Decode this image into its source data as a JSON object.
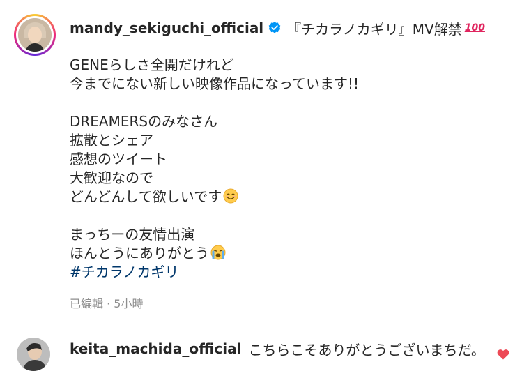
{
  "post": {
    "username": "mandy_sekiguchi_official",
    "title": "『チカラノカギリ』MV解禁",
    "title_emoji": "100",
    "caption_lines": [
      "GENEらしさ全開だけれど",
      "今までにない新しい映像作品になっています!!",
      "",
      "DREAMERSのみなさん",
      "拡散とシェア",
      "感想のツイート",
      "大歓迎なので",
      "どんどんして欲しいです",
      "",
      "まっちーの友情出演",
      "ほんとうにありがとう"
    ],
    "hashtag": "#チカラノカギリ",
    "meta": "已編輯 · 5小時"
  },
  "comment": {
    "username": "keita_machida_official",
    "text": "こちらこそありがとうございまちだ。"
  },
  "colors": {
    "verified": "#0095f6",
    "hashtag": "#00376b",
    "heart": "#ed4956",
    "muted": "#8e8e8e"
  },
  "icons": [
    "verified-badge-icon",
    "hundred-points-icon",
    "smiling-face-icon",
    "crying-face-icon",
    "heart-icon"
  ]
}
